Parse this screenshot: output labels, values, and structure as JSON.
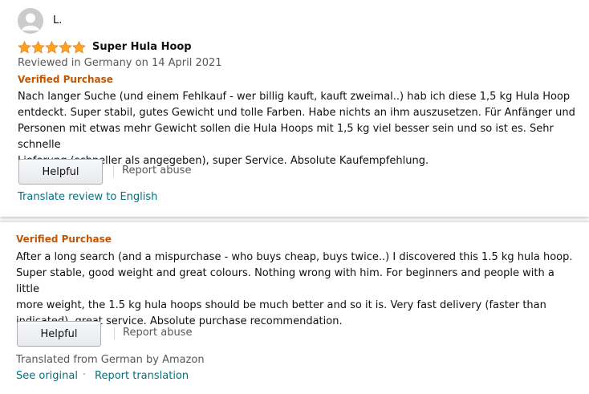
{
  "original_review": {
    "reviewer_name": "L.",
    "rating_stars": 5,
    "title": "Super Hula Hoop",
    "meta": "Reviewed in Germany on 14 April 2021",
    "verified_label": "Verified Purchase",
    "body_lines": [
      "Nach langer Suche (und einem Fehlkauf - wer billig kauft, kauft zweimal..) hab ich diese 1,5 kg Hula Hoop",
      "entdeckt. Super stabil, gutes Gewicht und tolle Farben. Habe nichts an ihm auszusetzen. Für Anfänger und",
      "Personen mit etwas mehr Gewicht sollen die Hula Hoops mit 1,5 kg viel besser sein und so ist es. Sehr schnelle",
      "Lieferung (schneller als angegeben), super Service. Absolute Kaufempfehlung."
    ],
    "helpful_label": "Helpful",
    "report_abuse_label": "Report abuse",
    "translate_link": "Translate review to English"
  },
  "translated_review": {
    "verified_label": "Verified Purchase",
    "body_lines": [
      "After a long search (and a mispurchase - who buys cheap, buys twice..) I discovered this 1.5 kg hula hoop.",
      "Super stable, good weight and great colours. Nothing wrong with him. For beginners and people with a little",
      "more weight, the 1.5 kg hula hoops should be much better and so it is. Very fast delivery (faster than",
      "indicated), great service. Absolute purchase recommendation."
    ],
    "helpful_label": "Helpful",
    "report_abuse_label": "Report abuse",
    "translated_from": "Translated from German by Amazon",
    "see_original_link": "See original",
    "separator": "·",
    "report_translation_link": "Report translation"
  },
  "colors": {
    "star": "#ffa41c",
    "verified": "#c45500",
    "link": "#007185",
    "secondary_text": "#565959"
  },
  "icons": {
    "avatar": "person-silhouette-icon",
    "star": "star-icon"
  }
}
